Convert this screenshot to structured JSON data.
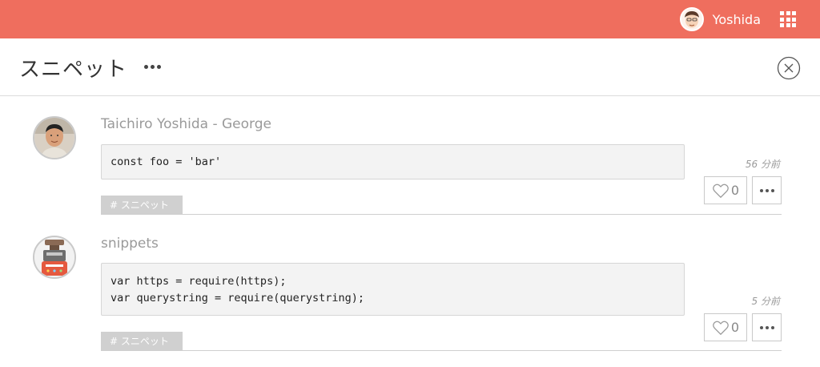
{
  "topbar": {
    "user_name": "Yoshida",
    "user_avatar_icon": "cartoon-face-avatar",
    "apps_icon": "grid-apps-icon",
    "background_color": "#ef6e5e"
  },
  "header": {
    "title": "スニペット",
    "more_icon": "more-horizontal-icon",
    "close_icon": "close-circle-icon"
  },
  "posts": [
    {
      "author": "Taichiro Yoshida - George",
      "code": "const foo = 'bar'",
      "time": "56 分前",
      "likes": "0",
      "tag": "# スニペット"
    },
    {
      "author": "snippets",
      "code": "var https = require(https);\nvar querystring = require(querystring);",
      "time": "5 分前",
      "likes": "0",
      "tag": "# スニペット"
    }
  ]
}
